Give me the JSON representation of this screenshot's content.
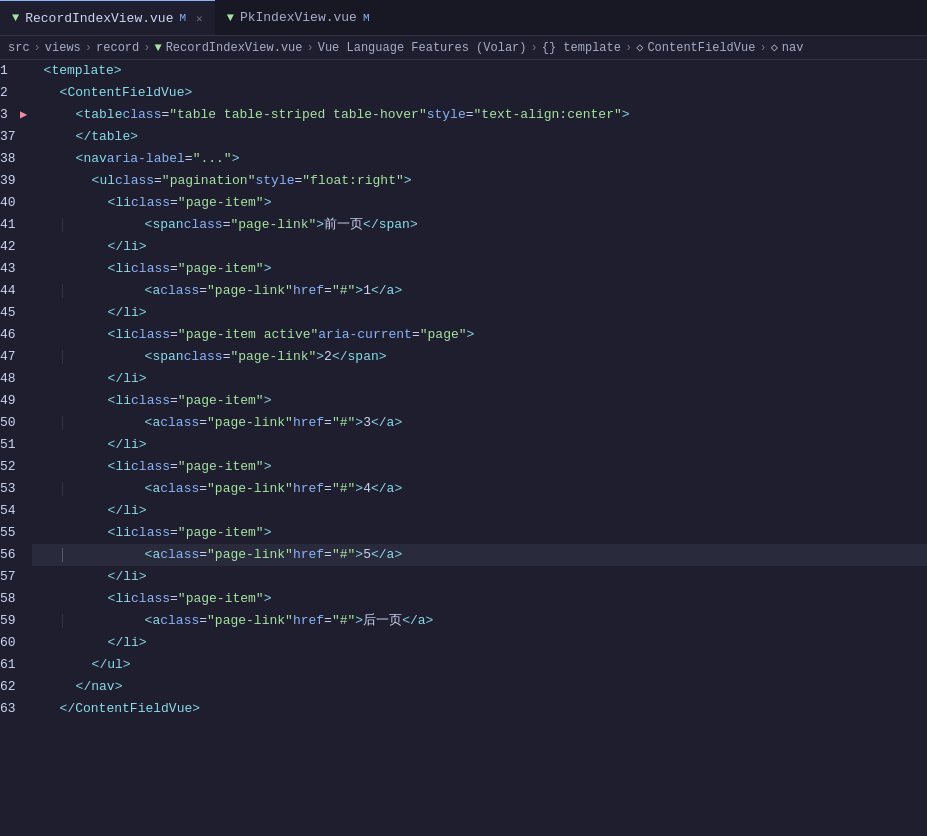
{
  "tabs": [
    {
      "id": "tab1",
      "label": "RecordIndexView.vue",
      "modified": true,
      "active": true,
      "icon": "▼"
    },
    {
      "id": "tab2",
      "label": "PkIndexView.vue",
      "modified": true,
      "active": false,
      "icon": "▼"
    }
  ],
  "breadcrumb": {
    "items": [
      {
        "label": "src",
        "type": "text"
      },
      {
        "label": ">",
        "type": "sep"
      },
      {
        "label": "views",
        "type": "text"
      },
      {
        "label": ">",
        "type": "sep"
      },
      {
        "label": "record",
        "type": "text"
      },
      {
        "label": ">",
        "type": "sep"
      },
      {
        "label": "▼",
        "type": "vue-icon"
      },
      {
        "label": "RecordIndexView.vue",
        "type": "text"
      },
      {
        "label": ">",
        "type": "sep"
      },
      {
        "label": "Vue Language Features (Volar)",
        "type": "text"
      },
      {
        "label": ">",
        "type": "sep"
      },
      {
        "label": "{} template",
        "type": "text"
      },
      {
        "label": ">",
        "type": "sep"
      },
      {
        "label": "◇",
        "type": "icon"
      },
      {
        "label": "ContentFieldVue",
        "type": "text"
      },
      {
        "label": ">",
        "type": "sep"
      },
      {
        "label": "◇",
        "type": "icon"
      },
      {
        "label": "nav",
        "type": "text"
      }
    ]
  },
  "lines": [
    {
      "num": 1,
      "arrow": "",
      "indent": 2,
      "code": "<template>"
    },
    {
      "num": 2,
      "arrow": "",
      "indent": 4,
      "code": "<ContentFieldVue>"
    },
    {
      "num": 3,
      "arrow": "▶",
      "indent": 6,
      "code": "<table class=\"table table-striped table-hover\" style=\"text-align:center\">"
    },
    {
      "num": 37,
      "arrow": "",
      "indent": 6,
      "code": "</table>"
    },
    {
      "num": 38,
      "arrow": "",
      "indent": 6,
      "code": "<nav aria-label=\"...\">"
    },
    {
      "num": 39,
      "arrow": "",
      "indent": 8,
      "code": "<ul class=\"pagination\" style=\"float:right\">"
    },
    {
      "num": 40,
      "arrow": "",
      "indent": 10,
      "code": "<li class=\"page-item\">"
    },
    {
      "num": 41,
      "arrow": "",
      "indent": 12,
      "code": "<span class=\"page-link\">前一页</span>"
    },
    {
      "num": 42,
      "arrow": "",
      "indent": 10,
      "code": "</li>"
    },
    {
      "num": 43,
      "arrow": "",
      "indent": 10,
      "code": "<li class=\"page-item\">"
    },
    {
      "num": 44,
      "arrow": "",
      "indent": 12,
      "code": "<a class=\"page-link\" href=\"#\">1</a>"
    },
    {
      "num": 45,
      "arrow": "",
      "indent": 10,
      "code": "</li>"
    },
    {
      "num": 46,
      "arrow": "",
      "indent": 10,
      "code": "<li class=\"page-item active\" aria-current=\"page\">"
    },
    {
      "num": 47,
      "arrow": "",
      "indent": 12,
      "code": "<span class=\"page-link\">2</span>"
    },
    {
      "num": 48,
      "arrow": "",
      "indent": 10,
      "code": "</li>"
    },
    {
      "num": 49,
      "arrow": "",
      "indent": 10,
      "code": "<li class=\"page-item\">"
    },
    {
      "num": 50,
      "arrow": "",
      "indent": 12,
      "code": "<a class=\"page-link\" href=\"#\">3</a>"
    },
    {
      "num": 51,
      "arrow": "",
      "indent": 10,
      "code": "</li>"
    },
    {
      "num": 52,
      "arrow": "",
      "indent": 10,
      "code": "<li class=\"page-item\">"
    },
    {
      "num": 53,
      "arrow": "",
      "indent": 12,
      "code": "<a class=\"page-link\" href=\"#\">4</a>"
    },
    {
      "num": 54,
      "arrow": "",
      "indent": 10,
      "code": "</li>"
    },
    {
      "num": 55,
      "arrow": "",
      "indent": 10,
      "code": "<li class=\"page-item\">"
    },
    {
      "num": 56,
      "arrow": "",
      "indent": 12,
      "code": "<a class=\"page-link\" href=\"#\">5</a>",
      "highlighted": true
    },
    {
      "num": 57,
      "arrow": "",
      "indent": 10,
      "code": "</li>"
    },
    {
      "num": 58,
      "arrow": "",
      "indent": 10,
      "code": "<li class=\"page-item\">"
    },
    {
      "num": 59,
      "arrow": "",
      "indent": 12,
      "code": "<a class=\"page-link\" href=\"#\">后一页</a>"
    },
    {
      "num": 60,
      "arrow": "",
      "indent": 10,
      "code": "</li>"
    },
    {
      "num": 61,
      "arrow": "",
      "indent": 8,
      "code": "</ul>"
    },
    {
      "num": 62,
      "arrow": "",
      "indent": 6,
      "code": "</nav>"
    },
    {
      "num": 63,
      "arrow": "",
      "indent": 4,
      "code": "</ContentFieldVue>"
    }
  ]
}
